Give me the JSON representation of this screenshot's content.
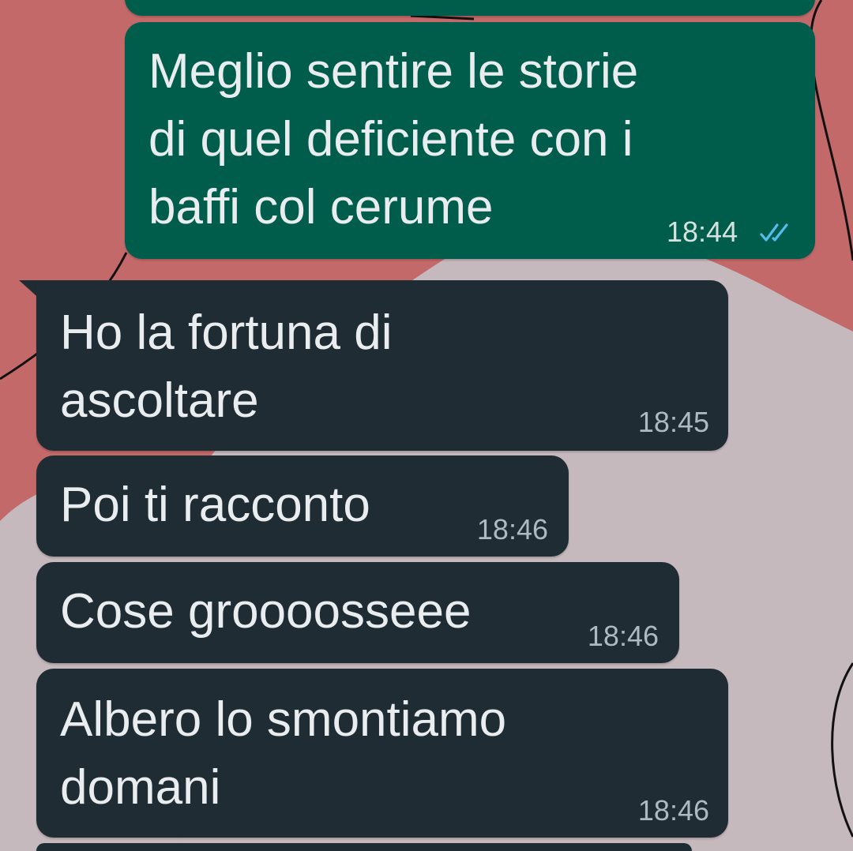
{
  "messages": [
    {
      "id": "m0",
      "direction": "outgoing",
      "text": "",
      "time": ""
    },
    {
      "id": "m1",
      "direction": "outgoing",
      "text": "Meglio sentire le storie\ndi quel deficiente con i\nbaffi col cerume",
      "time": "18:44",
      "status_icon": "double-check-read-icon"
    },
    {
      "id": "m2",
      "direction": "incoming",
      "text": "Ho la fortuna di\nascoltare",
      "time": "18:45"
    },
    {
      "id": "m3",
      "direction": "incoming",
      "text": "Poi ti racconto",
      "time": "18:46"
    },
    {
      "id": "m4",
      "direction": "incoming",
      "text": "Cose groooosseee",
      "time": "18:46"
    },
    {
      "id": "m5",
      "direction": "incoming",
      "text": "Albero lo smontiamo\ndomani",
      "time": "18:46"
    },
    {
      "id": "m6",
      "direction": "incoming",
      "text": "",
      "time": ""
    }
  ],
  "colors": {
    "wallpaper_rose": "#c4696a",
    "wallpaper_lilac": "#c6b9bd",
    "outgoing_bubble": "#005c4b",
    "incoming_bubble": "#202c33",
    "message_text": "#e9edef",
    "read_tick": "#53bdeb"
  }
}
